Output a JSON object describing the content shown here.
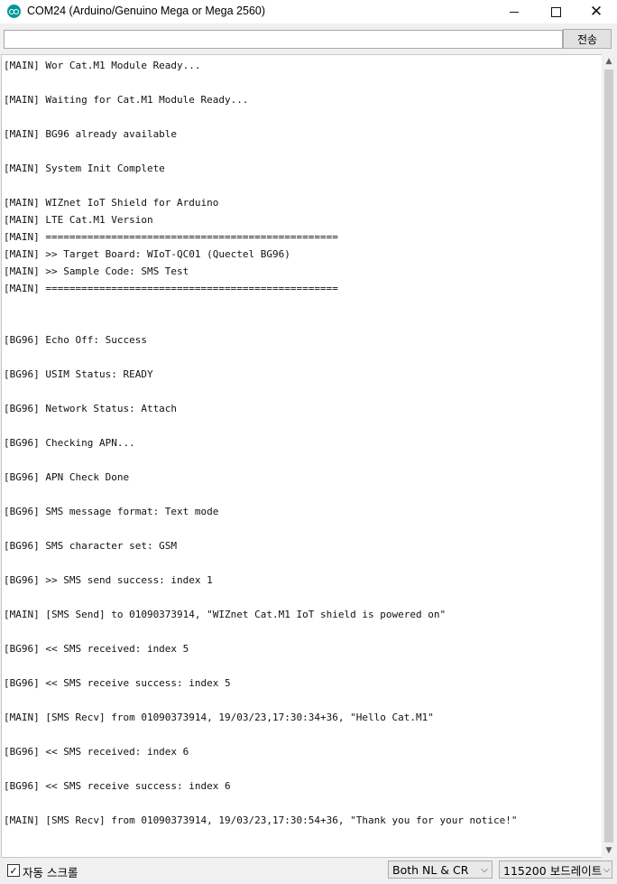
{
  "window": {
    "title": "COM24 (Arduino/Genuino Mega or Mega 2560)",
    "app_icon": "arduino-icon",
    "controls": {
      "minimize_icon": "minimize-icon",
      "maximize_icon": "maximize-icon",
      "close_icon": "close-icon"
    }
  },
  "send_bar": {
    "input_value": "",
    "send_label": "전송"
  },
  "serial_output": {
    "lines": [
      "[MAIN] Wor Cat.M1 Module Ready...",
      "",
      "[MAIN] Waiting for Cat.M1 Module Ready...",
      "",
      "[MAIN] BG96 already available",
      "",
      "[MAIN] System Init Complete",
      "",
      "[MAIN] WIZnet IoT Shield for Arduino",
      "[MAIN] LTE Cat.M1 Version",
      "[MAIN] =================================================",
      "[MAIN] >> Target Board: WIoT-QC01 (Quectel BG96)",
      "[MAIN] >> Sample Code: SMS Test",
      "[MAIN] =================================================",
      "",
      "",
      "[BG96] Echo Off: Success",
      "",
      "[BG96] USIM Status: READY",
      "",
      "[BG96] Network Status: Attach",
      "",
      "[BG96] Checking APN...",
      "",
      "[BG96] APN Check Done",
      "",
      "[BG96] SMS message format: Text mode",
      "",
      "[BG96] SMS character set: GSM",
      "",
      "[BG96] >> SMS send success: index 1",
      "",
      "[MAIN] [SMS Send] to 01090373914, \"WIZnet Cat.M1 IoT shield is powered on\"",
      "",
      "[BG96] << SMS received: index 5",
      "",
      "[BG96] << SMS receive success: index 5",
      "",
      "[MAIN] [SMS Recv] from 01090373914, 19/03/23,17:30:34+36, \"Hello Cat.M1\"",
      "",
      "[BG96] << SMS received: index 6",
      "",
      "[BG96] << SMS receive success: index 6",
      "",
      "[MAIN] [SMS Recv] from 01090373914, 19/03/23,17:30:54+36, \"Thank you for your notice!\""
    ]
  },
  "bottom_bar": {
    "autoscroll_label": "자동 스크롤",
    "autoscroll_checked": true,
    "line_ending_value": "Both NL & CR",
    "baud_value": "115200 보드레이트"
  },
  "colors": {
    "accent": "#00979c",
    "background": "#f0f0f0",
    "output_background": "#ffffff"
  }
}
